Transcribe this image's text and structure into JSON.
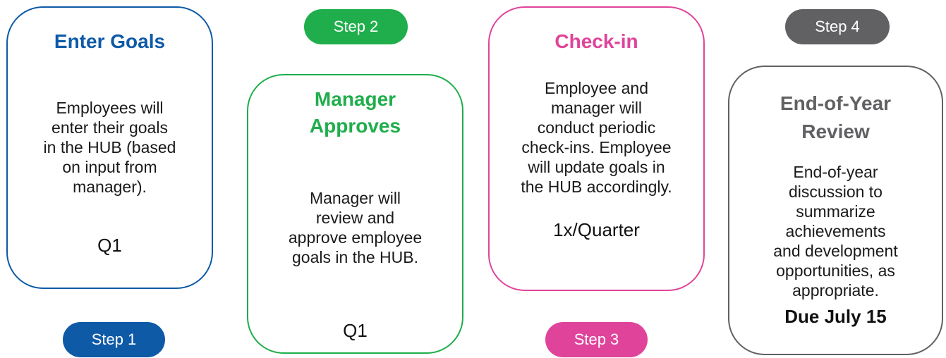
{
  "colors": {
    "step1": "#0e5aa7",
    "step2": "#1fae4b",
    "step3": "#e0449a",
    "step4": "#616164"
  },
  "steps": [
    {
      "pill": "Step 1",
      "title": "Enter Goals",
      "body": "Employees will\nenter their goals\nin the HUB (based\non input from\nmanager).",
      "timing": "Q1"
    },
    {
      "pill": "Step 2",
      "title": "Manager\nApproves",
      "body": "Manager will\nreview and\napprove employee\ngoals in the HUB.",
      "timing": "Q1"
    },
    {
      "pill": "Step 3",
      "title": "Check-in",
      "body": "Employee and\nmanager will\nconduct periodic\ncheck-ins. Employee\nwill update goals in\nthe HUB accordingly.",
      "timing": "1x/Quarter"
    },
    {
      "pill": "Step 4",
      "title": "End-of-Year\nReview",
      "body": "End-of-year\ndiscussion to\nsummarize\nachievements\nand development\nopportunities, as\nappropriate.",
      "timing": "Due July 15"
    }
  ]
}
